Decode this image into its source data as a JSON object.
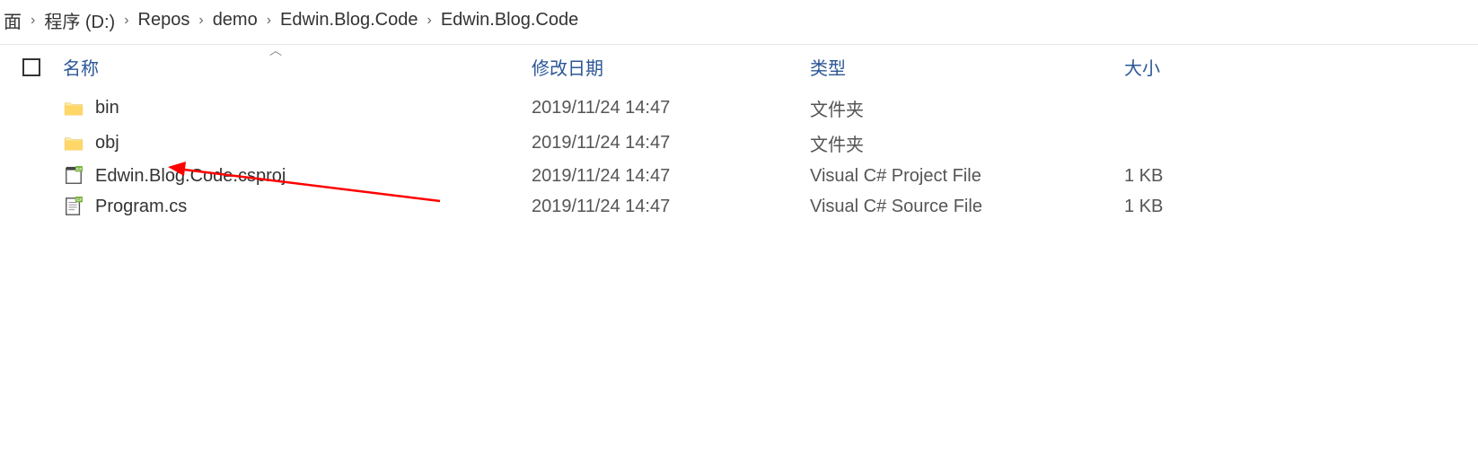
{
  "breadcrumb": {
    "items": [
      "面",
      "程序 (D:)",
      "Repos",
      "demo",
      "Edwin.Blog.Code",
      "Edwin.Blog.Code"
    ]
  },
  "columns": {
    "name": "名称",
    "date": "修改日期",
    "type": "类型",
    "size": "大小"
  },
  "rows": [
    {
      "name": "bin",
      "date": "2019/11/24 14:47",
      "type": "文件夹",
      "size": "",
      "icon": "folder"
    },
    {
      "name": "obj",
      "date": "2019/11/24 14:47",
      "type": "文件夹",
      "size": "",
      "icon": "folder"
    },
    {
      "name": "Edwin.Blog.Code.csproj",
      "date": "2019/11/24 14:47",
      "type": "Visual C# Project File",
      "size": "1 KB",
      "icon": "csproj"
    },
    {
      "name": "Program.cs",
      "date": "2019/11/24 14:47",
      "type": "Visual C# Source File",
      "size": "1 KB",
      "icon": "cs"
    }
  ]
}
